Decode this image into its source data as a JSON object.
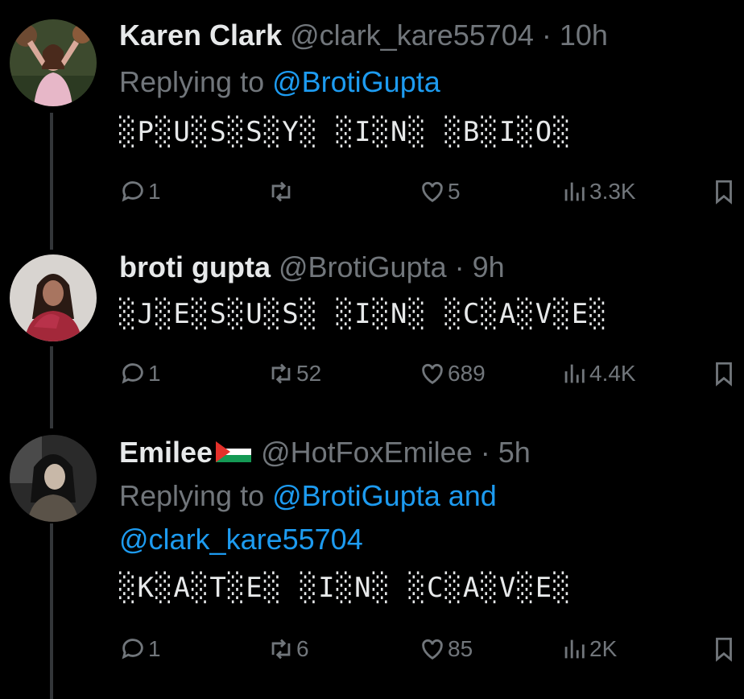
{
  "tweets": [
    {
      "name": "Karen Clark",
      "handle": "@clark_kare55704",
      "time": "· 10h",
      "reply_prefix": "Replying to ",
      "reply_line1": "@BrotiGupta",
      "reply_line2": "",
      "reply_mention2_prefix": "",
      "text": "░P░U░S░S░Y░ ░I░N░ ░B░I░O░",
      "actions": {
        "replies": "1",
        "retweets": "",
        "likes": "5",
        "views": "3.3K"
      }
    },
    {
      "name": "broti gupta",
      "handle": "@BrotiGupta",
      "time": "· 9h",
      "text": "░J░E░S░U░S░ ░I░N░ ░C░A░V░E░",
      "actions": {
        "replies": "1",
        "retweets": "52",
        "likes": "689",
        "views": "4.4K"
      }
    },
    {
      "name": "Emilee",
      "handle": "@HotFoxEmilee",
      "time": "· 5h",
      "reply_prefix": "Replying to ",
      "reply_mention1": "@BrotiGupta and",
      "reply_mention2": "@clark_kare55704",
      "text": "░K░A░T░E░ ░I░N░ ░C░A░V░E░",
      "actions": {
        "replies": "1",
        "retweets": "6",
        "likes": "85",
        "views": "2K"
      }
    }
  ],
  "colors": {
    "background": "#000000",
    "muted": "#71767b",
    "link": "#1d9bf0",
    "text": "#e7e9ea",
    "thread_line": "#333639"
  },
  "icons": [
    "reply-icon",
    "retweet-icon",
    "like-icon",
    "views-icon",
    "bookmark-icon"
  ]
}
